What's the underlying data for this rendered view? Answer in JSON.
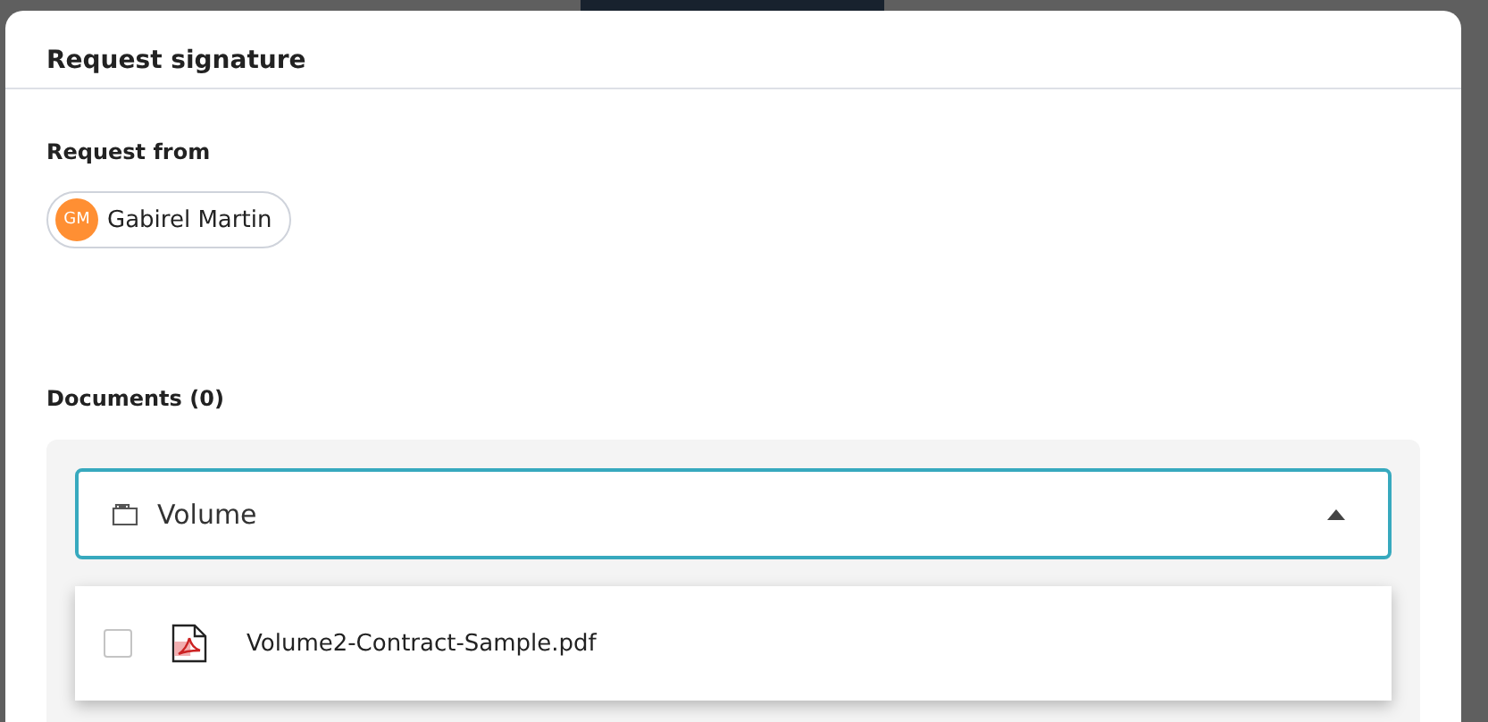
{
  "dialog": {
    "title": "Request signature"
  },
  "request_from": {
    "label": "Request from",
    "person": {
      "initials": "GM",
      "name": "Gabirel Martin"
    }
  },
  "documents": {
    "label": "Documents (0)",
    "folder_select": {
      "value": "Volume",
      "expanded": true
    },
    "options": [
      {
        "name": "Volume2-Contract-Sample.pdf",
        "checked": false
      }
    ]
  }
}
